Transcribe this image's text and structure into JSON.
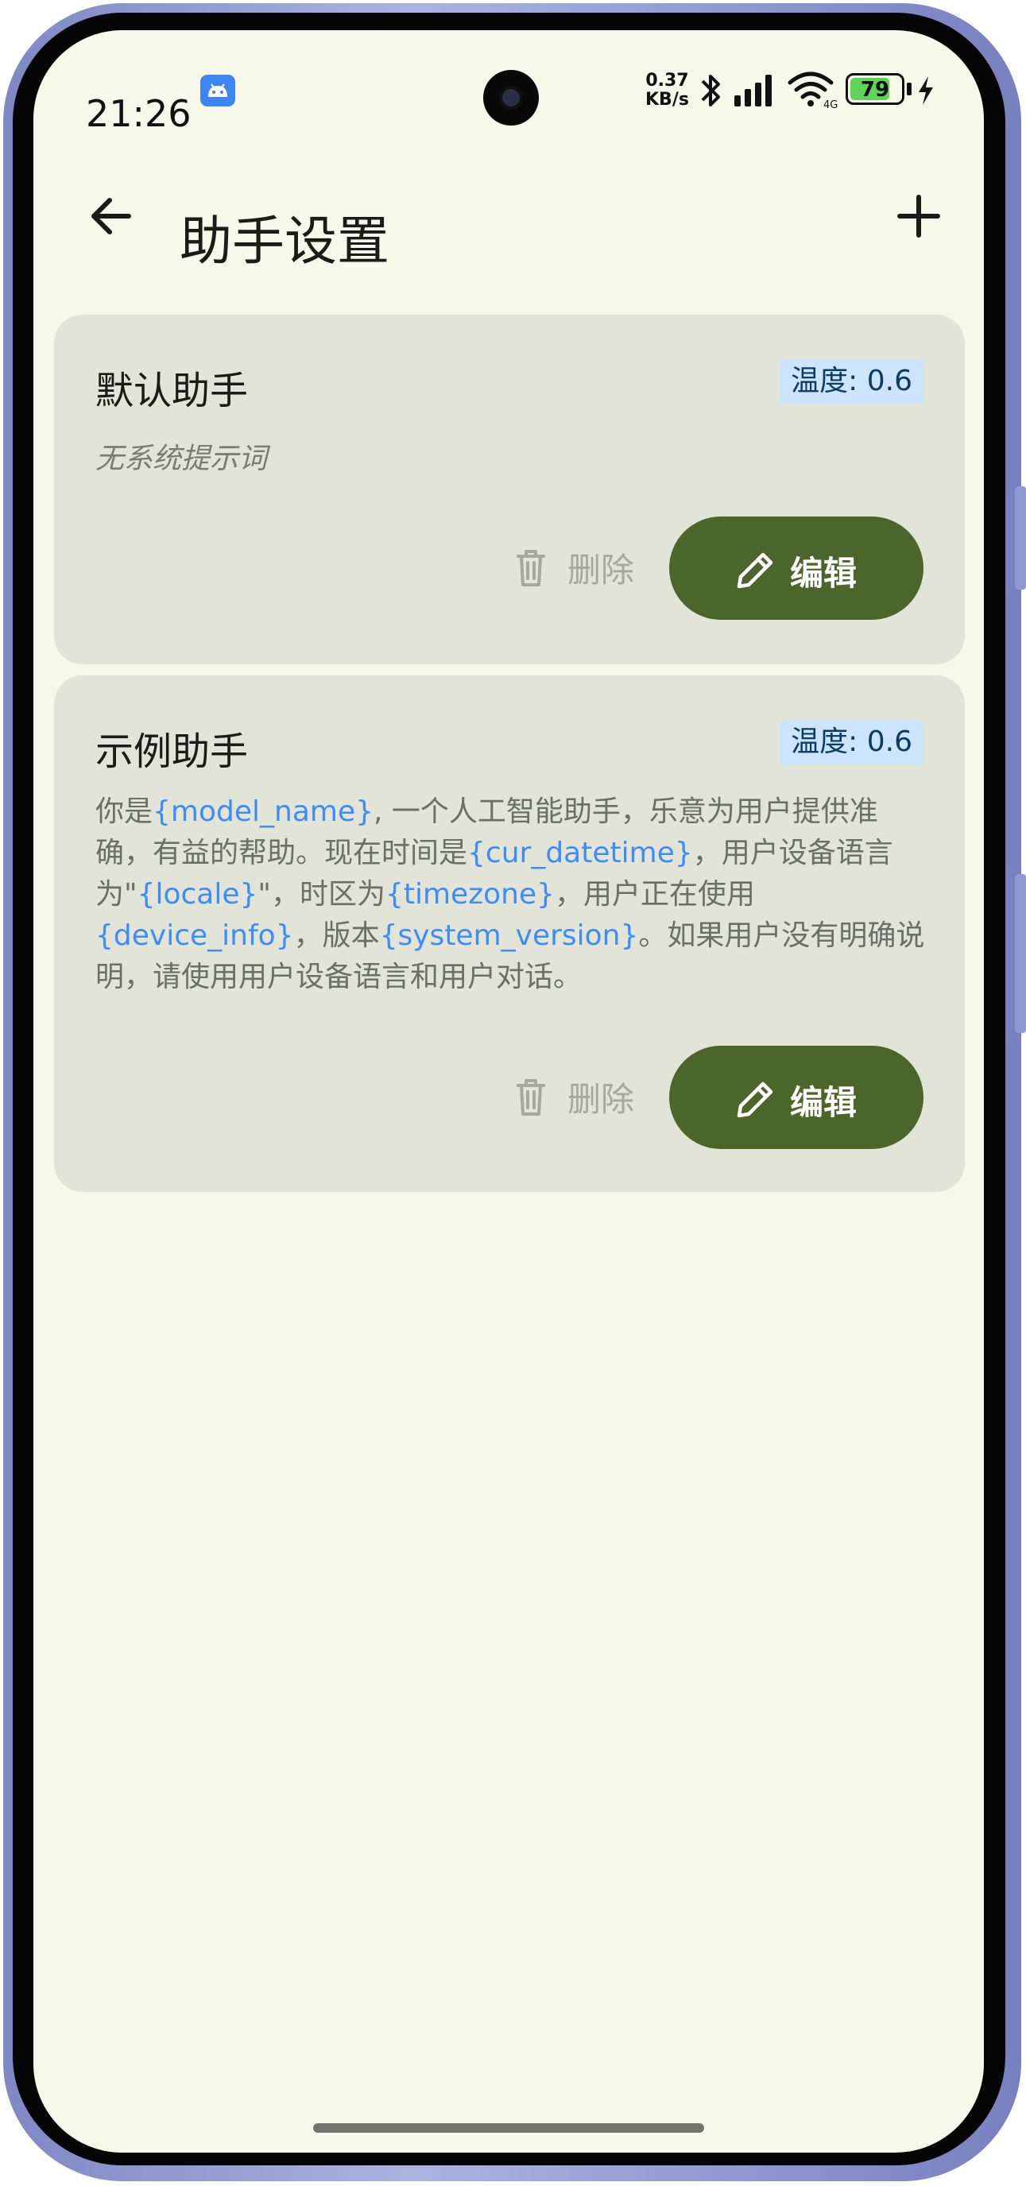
{
  "status_bar": {
    "time": "21:26",
    "net_speed_value": "0.37",
    "net_speed_unit": "KB/s",
    "battery": "79",
    "battery_level": 0.79,
    "icons": [
      "android-notification-icon",
      "bluetooth-icon",
      "signal-icon",
      "wifi-icon",
      "battery-icon",
      "charging-icon"
    ]
  },
  "app_bar": {
    "title": "助手设置",
    "back_icon": "arrow-left-icon",
    "add_icon": "plus-icon"
  },
  "assistants": [
    {
      "name": "默认助手",
      "temperature": "温度: 0.6",
      "prompt_empty": "无系统提示词",
      "delete_label": "删除",
      "edit_label": "编辑"
    },
    {
      "name": "示例助手",
      "temperature": "温度: 0.6",
      "prompt_parts": [
        {
          "text": "你是",
          "var": false
        },
        {
          "text": "{model_name}",
          "var": true
        },
        {
          "text": ", 一个人工智能助手，乐意为用户提供准确，有益的帮助。现在时间是",
          "var": false
        },
        {
          "text": "{cur_datetime}",
          "var": true
        },
        {
          "text": "，用户设备语言为\"",
          "var": false
        },
        {
          "text": "{locale}",
          "var": true
        },
        {
          "text": "\"，时区为",
          "var": false
        },
        {
          "text": "{timezone}",
          "var": true
        },
        {
          "text": "，用户正在使用",
          "var": false
        },
        {
          "text": "{device_info}",
          "var": true
        },
        {
          "text": "，版本",
          "var": false
        },
        {
          "text": "{system_version}",
          "var": true
        },
        {
          "text": "。如果用户没有明确说明，请使用用户设备语言和用户对话。",
          "var": false
        }
      ],
      "delete_label": "删除",
      "edit_label": "编辑"
    }
  ],
  "colors": {
    "background": "#f6f8ea",
    "card": "#e1e4d6",
    "primary": "#4c652a",
    "chip_bg": "#cce5fd",
    "variable_text": "#3d8df5"
  }
}
